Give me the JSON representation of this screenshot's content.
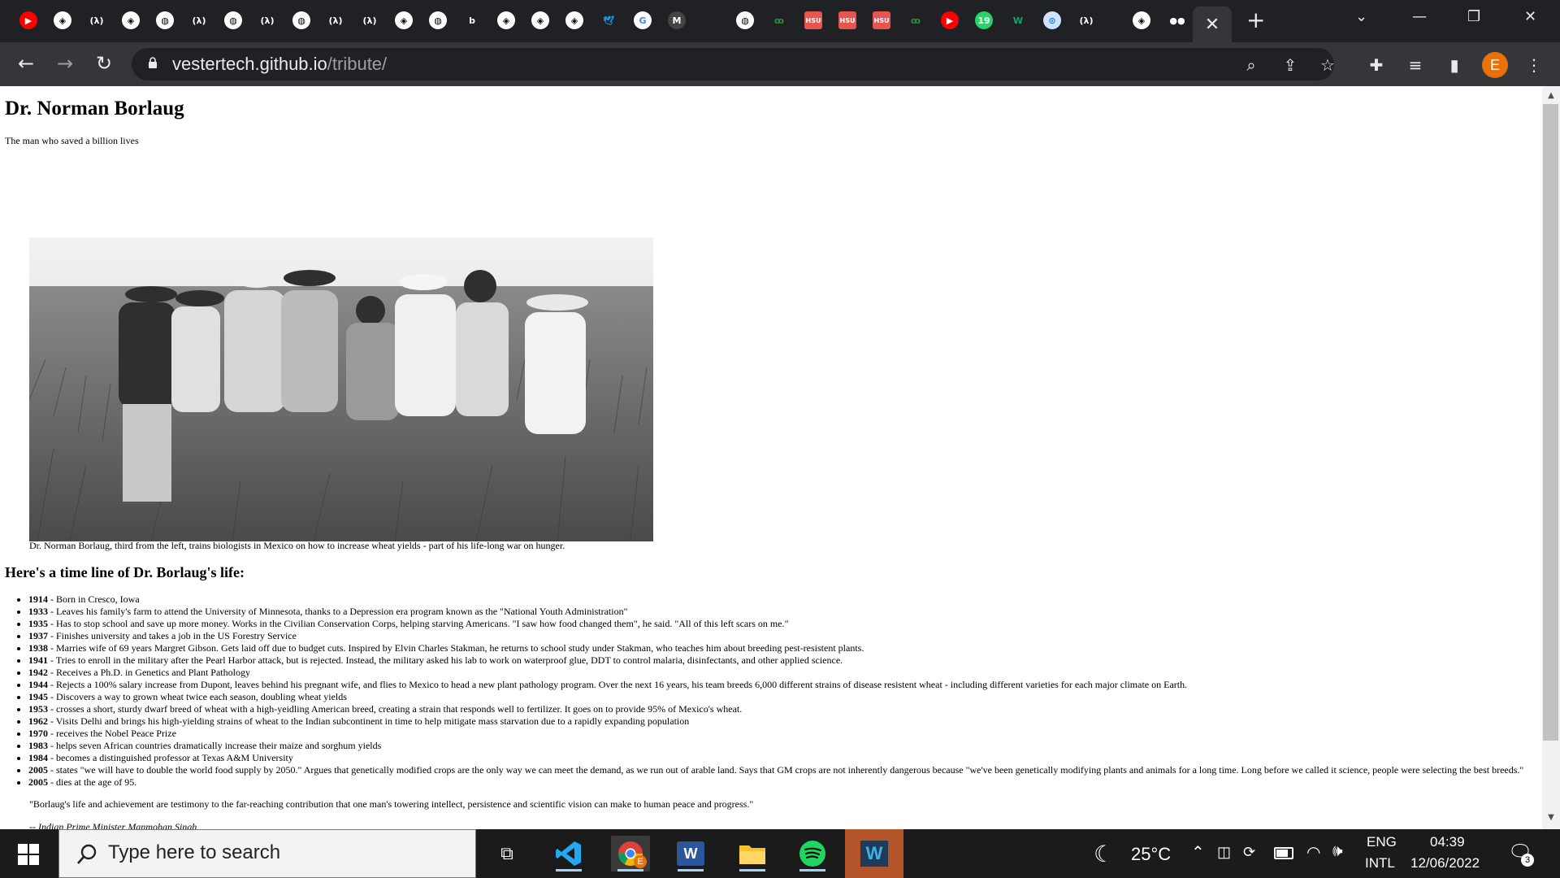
{
  "browser": {
    "tabs": [
      {
        "icon": "youtube-icon"
      },
      {
        "icon": "codepen-icon"
      },
      {
        "icon": "freecodecamp-icon"
      },
      {
        "icon": "codepen-icon"
      },
      {
        "icon": "globe-icon"
      },
      {
        "icon": "freecodecamp-icon"
      },
      {
        "icon": "globe-icon"
      },
      {
        "icon": "freecodecamp-icon"
      },
      {
        "icon": "globe-icon"
      },
      {
        "icon": "freecodecamp-icon"
      },
      {
        "icon": "freecodecamp-icon"
      },
      {
        "icon": "codepen-icon"
      },
      {
        "icon": "globe-icon"
      },
      {
        "icon": "bold-b-icon"
      },
      {
        "icon": "codepen-icon"
      },
      {
        "icon": "codepen-icon"
      },
      {
        "icon": "codepen-icon"
      },
      {
        "icon": "twitter-icon"
      },
      {
        "icon": "google-icon"
      },
      {
        "icon": "m-icon"
      },
      {
        "icon": "globe-icon"
      },
      {
        "icon": "geeksforgeeks-icon"
      },
      {
        "icon": "hsu-icon"
      },
      {
        "icon": "hsu-icon"
      },
      {
        "icon": "hsu-icon"
      },
      {
        "icon": "geeksforgeeks-icon"
      },
      {
        "icon": "youtube-icon"
      },
      {
        "icon": "whatsapp-icon"
      },
      {
        "icon": "w3schools-icon"
      },
      {
        "icon": "chrome-icon"
      },
      {
        "icon": "freecodecamp-icon"
      },
      {
        "icon": "codepen-icon"
      },
      {
        "icon": "medium-icon"
      }
    ],
    "hsu_label": "HSU",
    "whatsapp_count": "19",
    "b_label": "b",
    "m_label": "M",
    "w_label": "W",
    "fcc_label": "(λ)",
    "url_host": "vestertech.github.io",
    "url_path": "/tribute/",
    "profile_initial": "E",
    "accent_color": "#e8710a"
  },
  "page": {
    "title": "Dr. Norman Borlaug",
    "subtitle": "The man who saved a billion lives",
    "image_caption": "Dr. Norman Borlaug, third from the left, trains biologists in Mexico on how to increase wheat yields - part of his life-long war on hunger.",
    "timeline_heading": "Here's a time line of Dr. Borlaug's life:",
    "timeline": [
      {
        "year": "1914",
        "text": " - Born in Cresco, Iowa"
      },
      {
        "year": "1933",
        "text": " - Leaves his family's farm to attend the University of Minnesota, thanks to a Depression era program known as the \"National Youth Administration\""
      },
      {
        "year": "1935",
        "text": " - Has to stop school and save up more money. Works in the Civilian Conservation Corps, helping starving Americans. \"I saw how food changed them\", he said. \"All of this left scars on me.\""
      },
      {
        "year": "1937",
        "text": " - Finishes university and takes a job in the US Forestry Service"
      },
      {
        "year": "1938",
        "text": " - Marries wife of 69 years Margret Gibson. Gets laid off due to budget cuts. Inspired by Elvin Charles Stakman, he returns to school study under Stakman, who teaches him about breeding pest-resistent plants."
      },
      {
        "year": "1941",
        "text": " - Tries to enroll in the military after the Pearl Harbor attack, but is rejected. Instead, the military asked his lab to work on waterproof glue, DDT to control malaria, disinfectants, and other applied science."
      },
      {
        "year": "1942",
        "text": " - Receives a Ph.D. in Genetics and Plant Pathology"
      },
      {
        "year": "1944",
        "text": " - Rejects a 100% salary increase from Dupont, leaves behind his pregnant wife, and flies to Mexico to head a new plant pathology program. Over the next 16 years, his team breeds 6,000 different strains of disease resistent wheat - including different varieties for each major climate on Earth."
      },
      {
        "year": "1945",
        "text": " - Discovers a way to grown wheat twice each season, doubling wheat yields"
      },
      {
        "year": "1953",
        "text": " - crosses a short, sturdy dwarf breed of wheat with a high-yeidling American breed, creating a strain that responds well to fertilizer. It goes on to provide 95% of Mexico's wheat."
      },
      {
        "year": "1962",
        "text": " - Visits Delhi and brings his high-yielding strains of wheat to the Indian subcontinent in time to help mitigate mass starvation due to a rapidly expanding population"
      },
      {
        "year": "1970",
        "text": " - receives the Nobel Peace Prize"
      },
      {
        "year": "1983",
        "text": " - helps seven African countries dramatically increase their maize and sorghum yields"
      },
      {
        "year": "1984",
        "text": " - becomes a distinguished professor at Texas A&M University"
      },
      {
        "year": "2005",
        "text": " - states \"we will have to double the world food supply by 2050.\" Argues that genetically modified crops are the only way we can meet the demand, as we run out of arable land. Says that GM crops are not inherently dangerous because \"we've been genetically modifying plants and animals for a long time. Long before we called it science, people were selecting the best breeds.\""
      },
      {
        "year": "2005",
        "text": " - dies at the age of 95."
      }
    ],
    "quote": "\"Borlaug's life and achievement are testimony to the far-reaching contribution that one man's towering intellect, persistence and scientific vision can make to human peace and progress.\"",
    "quote_attribution": "-- Indian Prime Minister Manmohan Singh",
    "scroll_position": 0,
    "scroll_visible_fraction": 0.9
  },
  "taskbar": {
    "search_placeholder": "Type here to search",
    "apps": [
      "task-view-icon",
      "vscode-icon",
      "chrome-icon",
      "word-icon",
      "file-explorer-icon",
      "spotify-icon",
      "waves-icon"
    ],
    "chrome_badge": "E",
    "word_label": "W",
    "waves_label": "W",
    "weather": "25°C",
    "language_line1": "ENG",
    "language_line2": "INTL",
    "time": "04:39",
    "date": "12/06/2022",
    "notification_count": "3",
    "battery_level": 0.8
  }
}
